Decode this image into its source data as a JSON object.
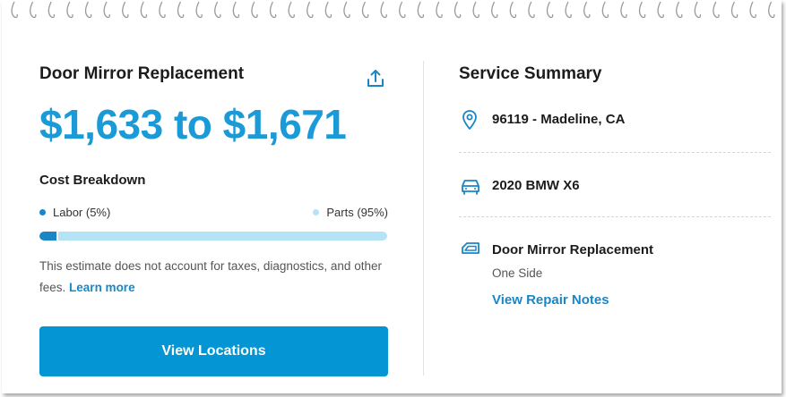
{
  "estimate": {
    "title": "Door Mirror Replacement",
    "price_range": "$1,633 to $1,671",
    "breakdown_title": "Cost Breakdown",
    "labor_label": "Labor (5%)",
    "parts_label": "Parts (95%)",
    "labor_fraction": 0.05,
    "parts_fraction": 0.95,
    "disclaimer": "This estimate does not account for taxes, diagnostics, and other fees.",
    "learn_more_label": "Learn more",
    "cta_label": "View Locations"
  },
  "summary": {
    "title": "Service Summary",
    "location": "96119 - Madeline, CA",
    "vehicle": "2020 BMW X6",
    "service_name": "Door Mirror Replacement",
    "service_detail": "One Side",
    "repair_notes_label": "View Repair Notes"
  },
  "icons": {
    "share": "share-icon",
    "location": "location-pin-icon",
    "vehicle": "car-icon",
    "service": "mirror-icon"
  },
  "colors": {
    "accent": "#1a9ad6",
    "button": "#0395d4",
    "labor_bar": "#1a86c6",
    "parts_bar": "#b4e3f5",
    "link": "#1a86c6"
  }
}
